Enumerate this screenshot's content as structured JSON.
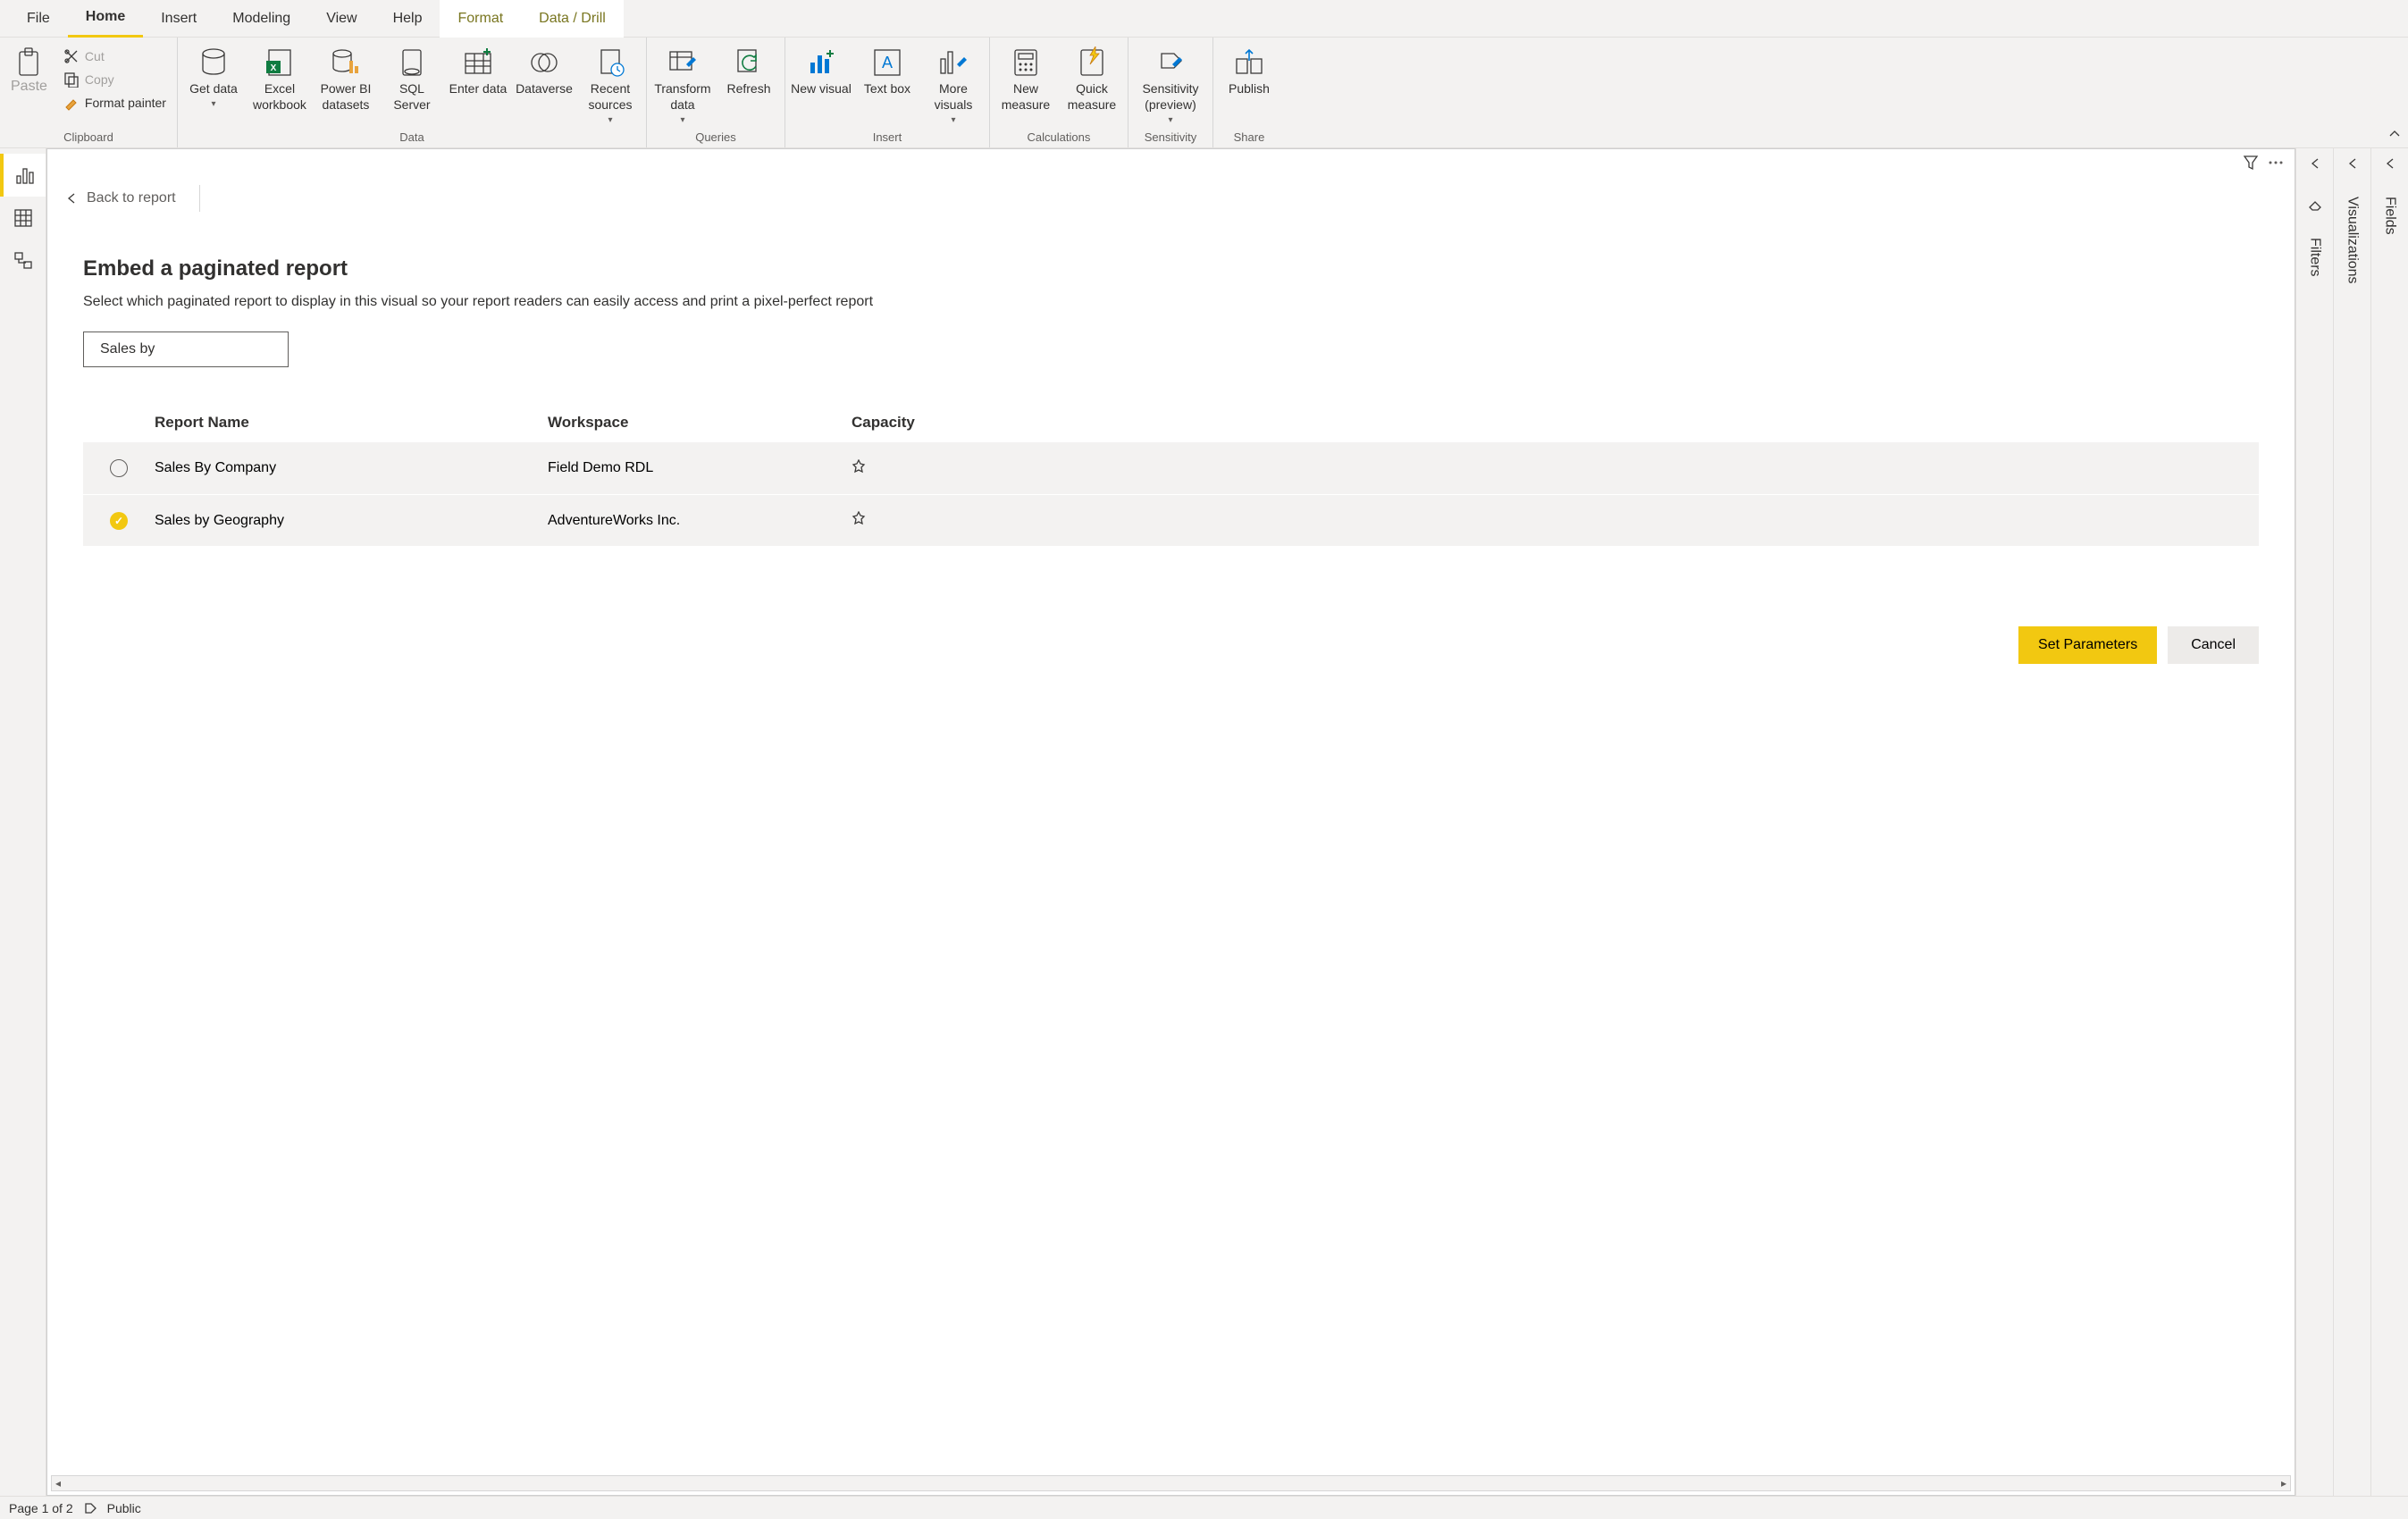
{
  "menubar": {
    "items": [
      "File",
      "Home",
      "Insert",
      "Modeling",
      "View",
      "Help",
      "Format",
      "Data / Drill"
    ]
  },
  "ribbon": {
    "clipboard": {
      "paste": "Paste",
      "cut": "Cut",
      "copy": "Copy",
      "format_painter": "Format painter",
      "group": "Clipboard"
    },
    "data": {
      "get_data": "Get data",
      "excel": "Excel workbook",
      "pbi_datasets": "Power BI datasets",
      "sql": "SQL Server",
      "enter": "Enter data",
      "dataverse": "Dataverse",
      "recent": "Recent sources",
      "group": "Data"
    },
    "queries": {
      "transform": "Transform data",
      "refresh": "Refresh",
      "group": "Queries"
    },
    "insert": {
      "new_visual": "New visual",
      "text_box": "Text box",
      "more_visuals": "More visuals",
      "group": "Insert"
    },
    "calculations": {
      "new_measure": "New measure",
      "quick_measure": "Quick measure",
      "group": "Calculations"
    },
    "sensitivity": {
      "sensitivity": "Sensitivity (preview)",
      "group": "Sensitivity"
    },
    "share": {
      "publish": "Publish",
      "group": "Share"
    }
  },
  "back_link": "Back to report",
  "content": {
    "title": "Embed a paginated report",
    "subtitle": "Select which paginated report to display in this visual so your report readers can easily access and print a pixel-perfect report",
    "search_value": "Sales by"
  },
  "table": {
    "headers": {
      "name": "Report Name",
      "workspace": "Workspace",
      "capacity": "Capacity"
    },
    "rows": [
      {
        "name": "Sales By Company",
        "workspace": "Field Demo RDL",
        "selected": false
      },
      {
        "name": "Sales by Geography",
        "workspace": "AdventureWorks Inc.",
        "selected": true
      }
    ]
  },
  "actions": {
    "primary": "Set Parameters",
    "secondary": "Cancel"
  },
  "panes": {
    "filters": "Filters",
    "viz": "Visualizations",
    "fields": "Fields"
  },
  "status": {
    "page": "Page 1 of 2",
    "sensitivity": "Public"
  }
}
